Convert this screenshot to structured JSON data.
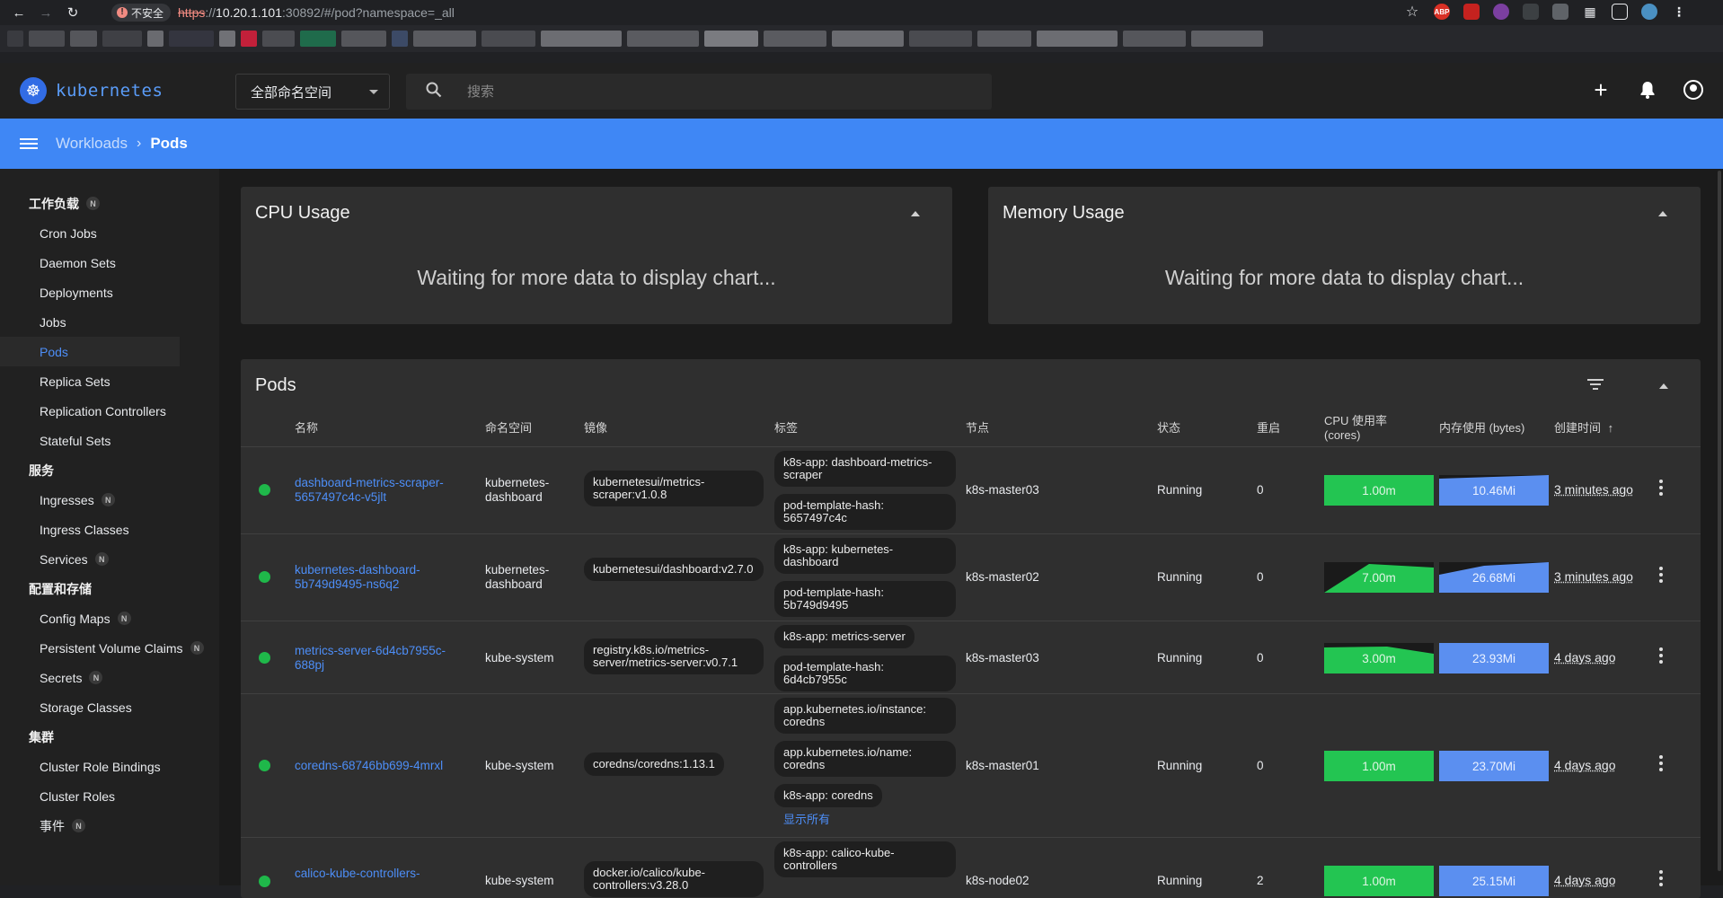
{
  "browser": {
    "insecure_label": "不安全",
    "url_protocol": "https",
    "url_host": "10.20.1.101",
    "url_rest": ":30892/#/pod?namespace=_all"
  },
  "app": {
    "logo_text": "kubernetes",
    "namespace_selected": "全部命名空间",
    "search_placeholder": "搜索"
  },
  "breadcrumb": {
    "parent": "Workloads",
    "current": "Pods"
  },
  "sidebar": {
    "groups": [
      {
        "label": "工作负载",
        "badge": "N"
      },
      {
        "label": "服务"
      },
      {
        "label": "配置和存储"
      },
      {
        "label": "集群"
      }
    ],
    "workloads": [
      "Cron Jobs",
      "Daemon Sets",
      "Deployments",
      "Jobs",
      "Pods",
      "Replica Sets",
      "Replication Controllers",
      "Stateful Sets"
    ],
    "services": [
      "Ingresses",
      "Ingress Classes",
      "Services"
    ],
    "config": [
      "Config Maps",
      "Persistent Volume Claims",
      "Secrets",
      "Storage Classes"
    ],
    "cluster": [
      "Cluster Role Bindings",
      "Cluster Roles",
      "事件"
    ],
    "badge": "N"
  },
  "cpu_card": {
    "title": "CPU Usage",
    "message": "Waiting for more data to display chart..."
  },
  "memory_card": {
    "title": "Memory Usage",
    "message": "Waiting for more data to display chart..."
  },
  "pods_card": {
    "title": "Pods",
    "columns": {
      "name": "名称",
      "namespace": "命名空间",
      "image": "镜像",
      "labels": "标签",
      "node": "节点",
      "status": "状态",
      "restarts": "重启",
      "cpu": "CPU 使用率 (cores)",
      "memory": "内存使用 (bytes)",
      "created": "创建时间"
    },
    "show_all": "显示所有",
    "rows": [
      {
        "name": "dashboard-metrics-scraper-5657497c4c-v5jlt",
        "namespace": "kubernetes-dashboard",
        "image": "kubernetesui/metrics-scraper:v1.0.8",
        "labels": [
          "k8s-app: dashboard-metrics-scraper",
          "pod-template-hash: 5657497c4c"
        ],
        "node": "k8s-master03",
        "status": "Running",
        "restarts": "0",
        "cpu": "1.00m",
        "memory": "10.46Mi",
        "created": "3 minutes ago"
      },
      {
        "name": "kubernetes-dashboard-5b749d9495-ns6q2",
        "namespace": "kubernetes-dashboard",
        "image": "kubernetesui/dashboard:v2.7.0",
        "labels": [
          "k8s-app: kubernetes-dashboard",
          "pod-template-hash: 5b749d9495"
        ],
        "node": "k8s-master02",
        "status": "Running",
        "restarts": "0",
        "cpu": "7.00m",
        "memory": "26.68Mi",
        "created": "3 minutes ago"
      },
      {
        "name": "metrics-server-6d4cb7955c-688pj",
        "namespace": "kube-system",
        "image": "registry.k8s.io/metrics-server/metrics-server:v0.7.1",
        "labels": [
          "k8s-app: metrics-server",
          "pod-template-hash: 6d4cb7955c"
        ],
        "node": "k8s-master03",
        "status": "Running",
        "restarts": "0",
        "cpu": "3.00m",
        "memory": "23.93Mi",
        "created": "4 days ago"
      },
      {
        "name": "coredns-68746bb699-4mrxl",
        "namespace": "kube-system",
        "image": "coredns/coredns:1.13.1",
        "labels": [
          "app.kubernetes.io/instance: coredns",
          "app.kubernetes.io/name: coredns",
          "k8s-app: coredns"
        ],
        "node": "k8s-master01",
        "status": "Running",
        "restarts": "0",
        "cpu": "1.00m",
        "memory": "23.70Mi",
        "created": "4 days ago"
      },
      {
        "name": "calico-kube-controllers-",
        "namespace": "kube-system",
        "image": "docker.io/calico/kube-controllers:v3.28.0",
        "labels": [
          "k8s-app: calico-kube-controllers"
        ],
        "node": "k8s-node02",
        "status": "Running",
        "restarts": "2",
        "cpu": "1.00m",
        "memory": "25.15Mi",
        "created": "4 days ago"
      }
    ]
  },
  "colors": {
    "accent": "#3f87f5",
    "link": "#4d8ef7",
    "running": "#1fb84a",
    "cpu_spark": "#23c552",
    "mem_spark": "#5b8ff0"
  }
}
